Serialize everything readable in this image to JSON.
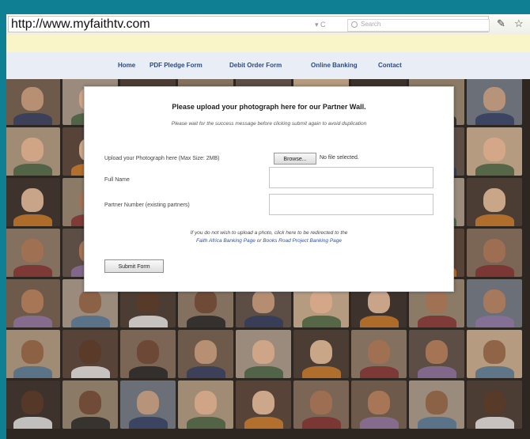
{
  "browser": {
    "url": "http://www.myfaithtv.com",
    "url_controls": "▾ C",
    "search_placeholder": "Search"
  },
  "nav": {
    "items": [
      "Home",
      "PDF Pledge Form",
      "Debit Order Form",
      "Online Banking",
      "Contact"
    ]
  },
  "form": {
    "title": "Please upload your photograph here for our Partner Wall.",
    "note": "Please wait for the success message before clicking submit again to avoid duplication",
    "upload_label": "Upload your Photograph here (Max Size: 2MB)",
    "browse_label": "Browse...",
    "file_status": "No file selected.",
    "fullname_label": "Full Name",
    "partner_label": "Partner Number (existing partners)",
    "redirect_text_1": "If you do not wish to upload a photo, click here to be redirected to the",
    "redirect_link_1": "Faith Africa Banking Page",
    "redirect_or": "or",
    "redirect_link_2": "Books Road Project Banking Page",
    "submit_label": "Submit Form"
  },
  "colors": {
    "frame": "#0f7f93",
    "notice": "#f9f5c9",
    "nav_bg": "#e9edf6",
    "link": "#2a4fb0"
  }
}
